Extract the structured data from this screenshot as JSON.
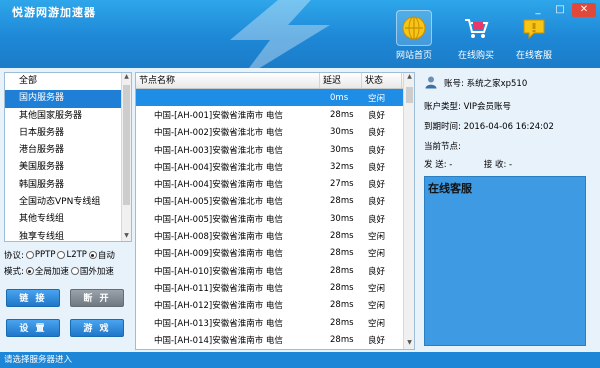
{
  "window": {
    "title": "悦游网游加速器",
    "controls": {
      "minimize": "_",
      "maximize": "□",
      "close": "✕"
    }
  },
  "nav": [
    {
      "label": "网站首页",
      "icon": "home-globe-icon",
      "active": true
    },
    {
      "label": "在线购买",
      "icon": "cart-icon",
      "active": false
    },
    {
      "label": "在线客服",
      "icon": "chat-bubble-icon",
      "active": false
    }
  ],
  "categories": [
    "全部",
    "国内服务器",
    "其他国家服务器",
    "日本服务器",
    "港台服务器",
    "美国服务器",
    "韩国服务器",
    "全国动态VPN专线组",
    "其他专线组",
    "独享专线组"
  ],
  "selected_category": "国内服务器",
  "protocol": {
    "label": "协议:",
    "options": [
      "PPTP",
      "L2TP",
      "自动"
    ],
    "selected": "自动"
  },
  "mode": {
    "label": "模式:",
    "options": [
      "全局加速",
      "国外加速"
    ],
    "selected": "全局加速"
  },
  "buttons": {
    "connect": "链 接",
    "disconnect": "断 开",
    "settings": "设 置",
    "games": "游 戏"
  },
  "table": {
    "headers": [
      "节点名称",
      "延迟",
      "状态"
    ],
    "rows": [
      {
        "name": "",
        "latency": "0ms",
        "status": "空闲",
        "selected": true
      },
      {
        "name": "中国-[AH-001]安徽省淮南市 电信",
        "latency": "28ms",
        "status": "良好"
      },
      {
        "name": "中国-[AH-002]安徽省淮北市 电信",
        "latency": "30ms",
        "status": "良好"
      },
      {
        "name": "中国-[AH-003]安徽省淮北市 电信",
        "latency": "30ms",
        "status": "良好"
      },
      {
        "name": "中国-[AH-004]安徽省淮北市 电信",
        "latency": "32ms",
        "status": "良好"
      },
      {
        "name": "中国-[AH-004]安徽省淮南市 电信",
        "latency": "27ms",
        "status": "良好"
      },
      {
        "name": "中国-[AH-005]安徽省淮北市 电信",
        "latency": "28ms",
        "status": "良好"
      },
      {
        "name": "中国-[AH-005]安徽省淮南市 电信",
        "latency": "30ms",
        "status": "良好"
      },
      {
        "name": "中国-[AH-008]安徽省淮南市 电信",
        "latency": "28ms",
        "status": "空闲"
      },
      {
        "name": "中国-[AH-009]安徽省淮南市 电信",
        "latency": "28ms",
        "status": "空闲"
      },
      {
        "name": "中国-[AH-010]安徽省淮南市 电信",
        "latency": "28ms",
        "status": "良好"
      },
      {
        "name": "中国-[AH-011]安徽省淮南市 电信",
        "latency": "28ms",
        "status": "空闲"
      },
      {
        "name": "中国-[AH-012]安徽省淮南市 电信",
        "latency": "28ms",
        "status": "空闲"
      },
      {
        "name": "中国-[AH-013]安徽省淮南市 电信",
        "latency": "28ms",
        "status": "空闲"
      },
      {
        "name": "中国-[AH-014]安徽省淮南市 电信",
        "latency": "28ms",
        "status": "良好"
      }
    ]
  },
  "account": {
    "account_label": "账号:",
    "account_value": "系统之家xp510",
    "type_label": "账户类型:",
    "type_value": "VIP会员账号",
    "expire_label": "到期时间:",
    "expire_value": "2016-04-06 16:24:02",
    "node_label": "当前节点:",
    "node_value": "",
    "send_label": "发 送:",
    "send_value": "-",
    "recv_label": "接 收:",
    "recv_value": "-"
  },
  "support": {
    "title": "在线客服"
  },
  "status_bar": "请选择服务器进入",
  "colors": {
    "accent": "#1f8ce6",
    "header": "#2196e0",
    "panel_bg": "#e8f2fb"
  }
}
